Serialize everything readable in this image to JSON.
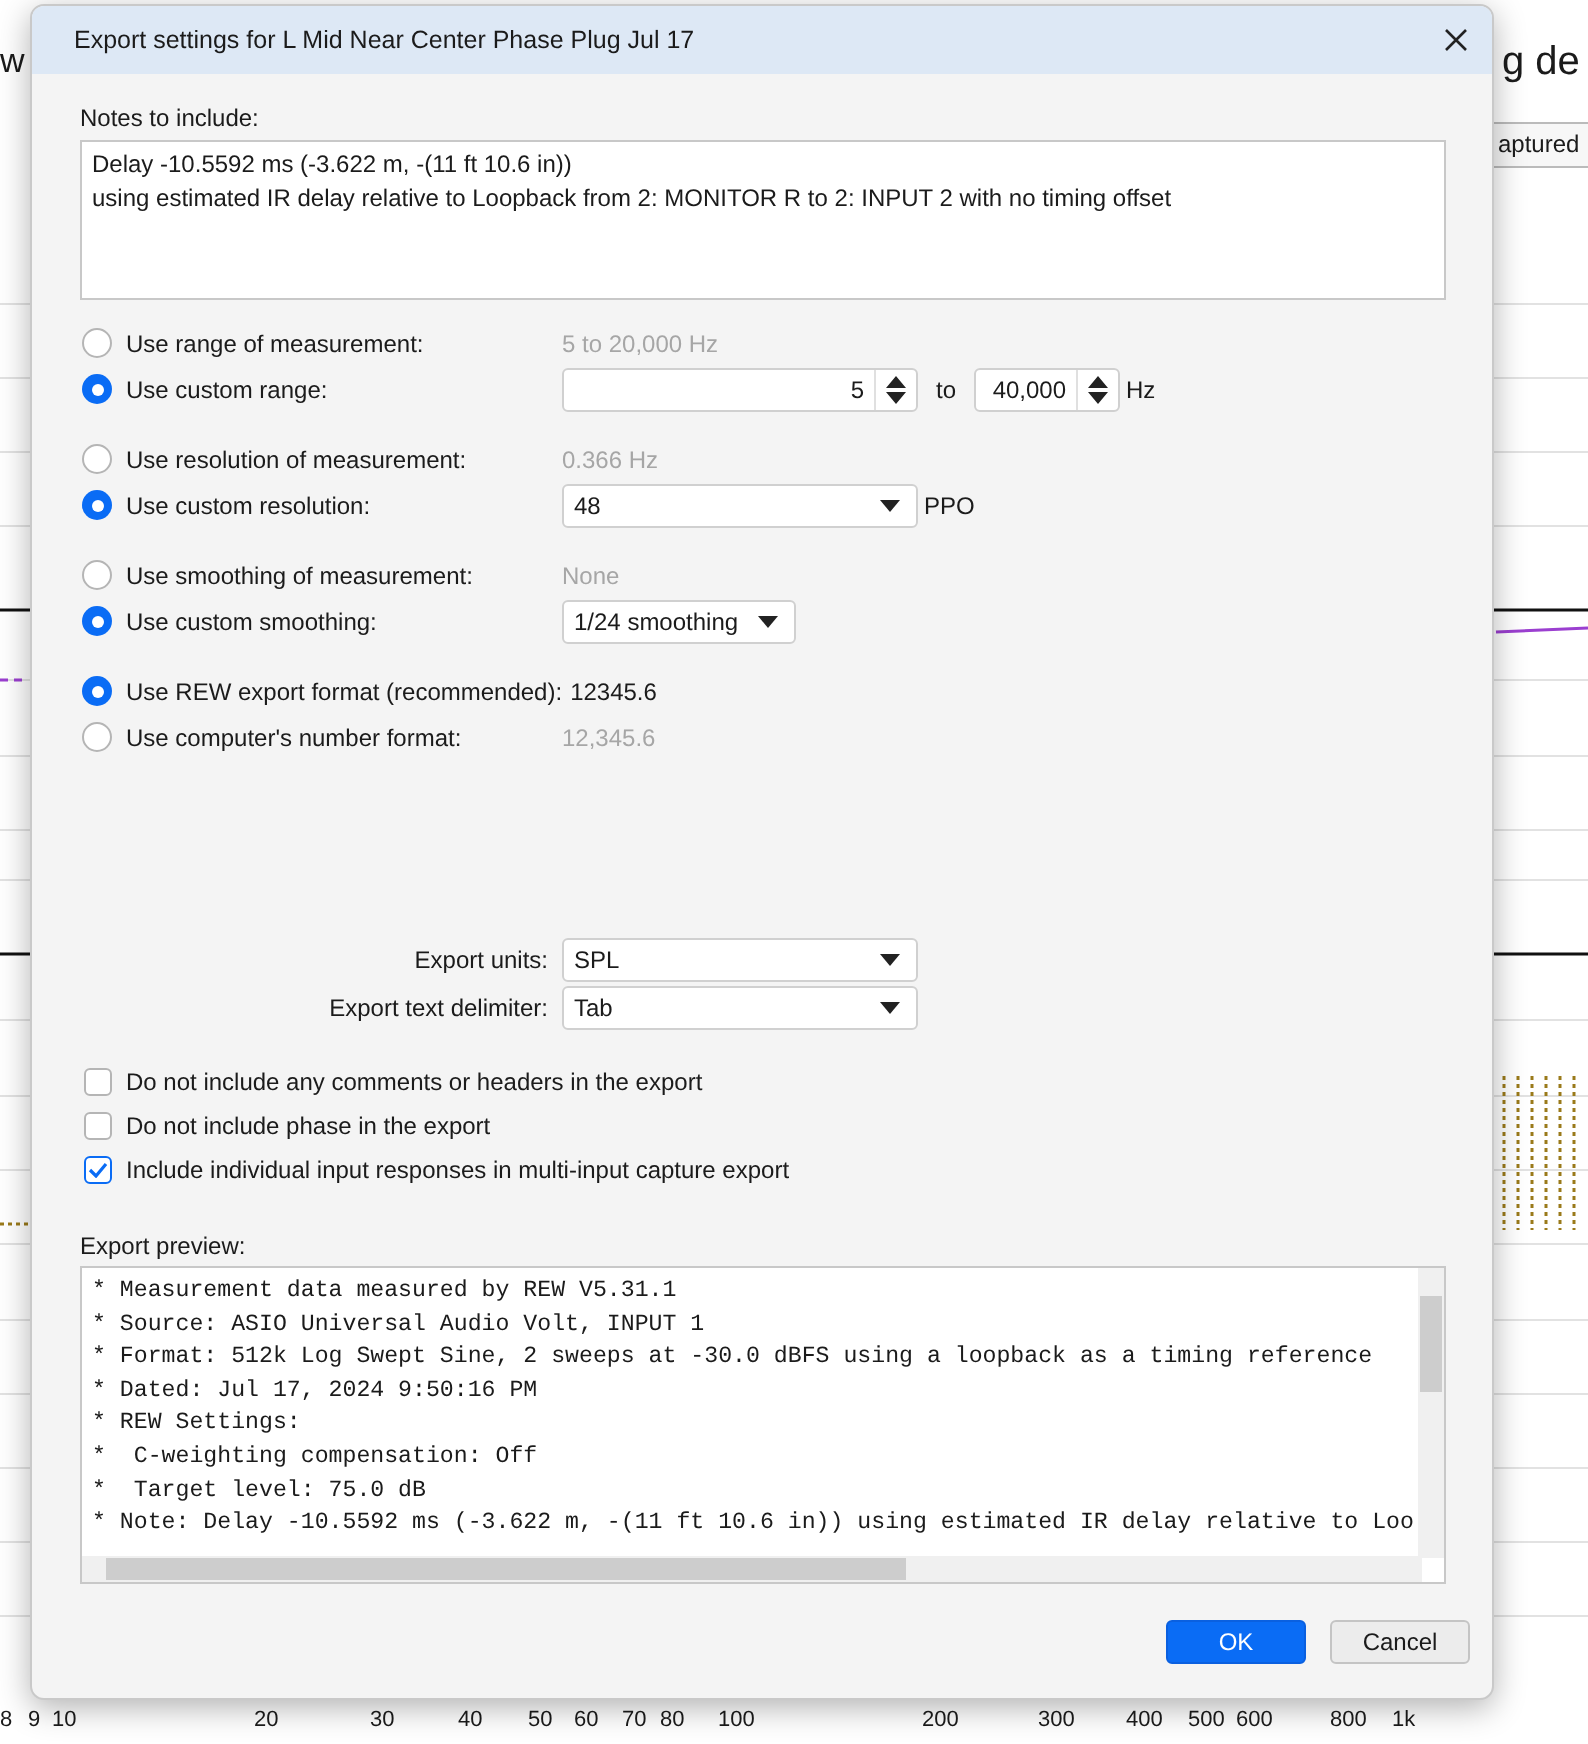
{
  "background": {
    "heading_left": "w",
    "heading_right": "g de",
    "button": "aptured",
    "axis_labels": [
      "8",
      "9",
      "10",
      "20",
      "30",
      "40",
      "50",
      "60",
      "70",
      "80",
      "100",
      "200",
      "300",
      "400",
      "500",
      "600",
      "800",
      "1k"
    ]
  },
  "dialog": {
    "title": "Export settings for L Mid Near Center Phase Plug Jul 17",
    "notes": {
      "label": "Notes to include:",
      "lines": [
        "Delay -10.5592 ms (-3.622 m, -(11 ft 10.6 in))",
        "using estimated IR delay relative to Loopback from 2: MONITOR R to 2: INPUT 2 with no timing offset"
      ]
    },
    "option_groups": [
      {
        "items": [
          {
            "kind": "text",
            "label": "Use range of measurement:",
            "selected": false,
            "value": "5 to 20,000 Hz"
          },
          {
            "kind": "range",
            "label": "Use custom range:",
            "selected": true,
            "from": "5",
            "joiner": "to",
            "to": "40,000",
            "unit": "Hz"
          }
        ]
      },
      {
        "items": [
          {
            "kind": "text",
            "label": "Use resolution of measurement:",
            "selected": false,
            "value": "0.366 Hz"
          },
          {
            "kind": "dropdown",
            "label": "Use custom resolution:",
            "selected": true,
            "value": "48",
            "unit": "PPO"
          }
        ]
      },
      {
        "items": [
          {
            "kind": "text",
            "label": "Use smoothing of measurement:",
            "selected": false,
            "value": "None"
          },
          {
            "kind": "compact_dropdown",
            "label": "Use custom smoothing:",
            "selected": true,
            "value": "1/24 smoothing"
          }
        ]
      },
      {
        "items": [
          {
            "kind": "text",
            "label": "Use REW export format (recommended):",
            "selected": true,
            "value": "12345.6"
          },
          {
            "kind": "text",
            "label": "Use computer's number format:",
            "selected": false,
            "value": "12,345.6"
          }
        ]
      }
    ],
    "selects": [
      {
        "label": "Export units:",
        "value": "SPL"
      },
      {
        "label": "Export text delimiter:",
        "value": "Tab"
      }
    ],
    "checkboxes": [
      {
        "label": "Do not include any comments or headers in the export",
        "checked": false
      },
      {
        "label": "Do not include phase in the export",
        "checked": false
      },
      {
        "label": "Include individual input responses in multi-input capture export",
        "checked": true
      }
    ],
    "preview": {
      "label": "Export preview:",
      "lines": [
        "* Measurement data measured by REW V5.31.1",
        "* Source: ASIO Universal Audio Volt, INPUT 1",
        "* Format: 512k Log Swept Sine, 2 sweeps at -30.0 dBFS using a loopback as a timing reference",
        "* Dated: Jul 17, 2024 9:50:16 PM",
        "* REW Settings:",
        "*  C-weighting compensation: Off",
        "*  Target level: 75.0 dB",
        "* Note: Delay -10.5592 ms (-3.622 m, -(11 ft 10.6 in)) using estimated IR delay relative to Loo"
      ]
    },
    "buttons": [
      {
        "label": "OK",
        "kind": "primary"
      },
      {
        "label": "Cancel",
        "kind": "secondary"
      }
    ]
  }
}
